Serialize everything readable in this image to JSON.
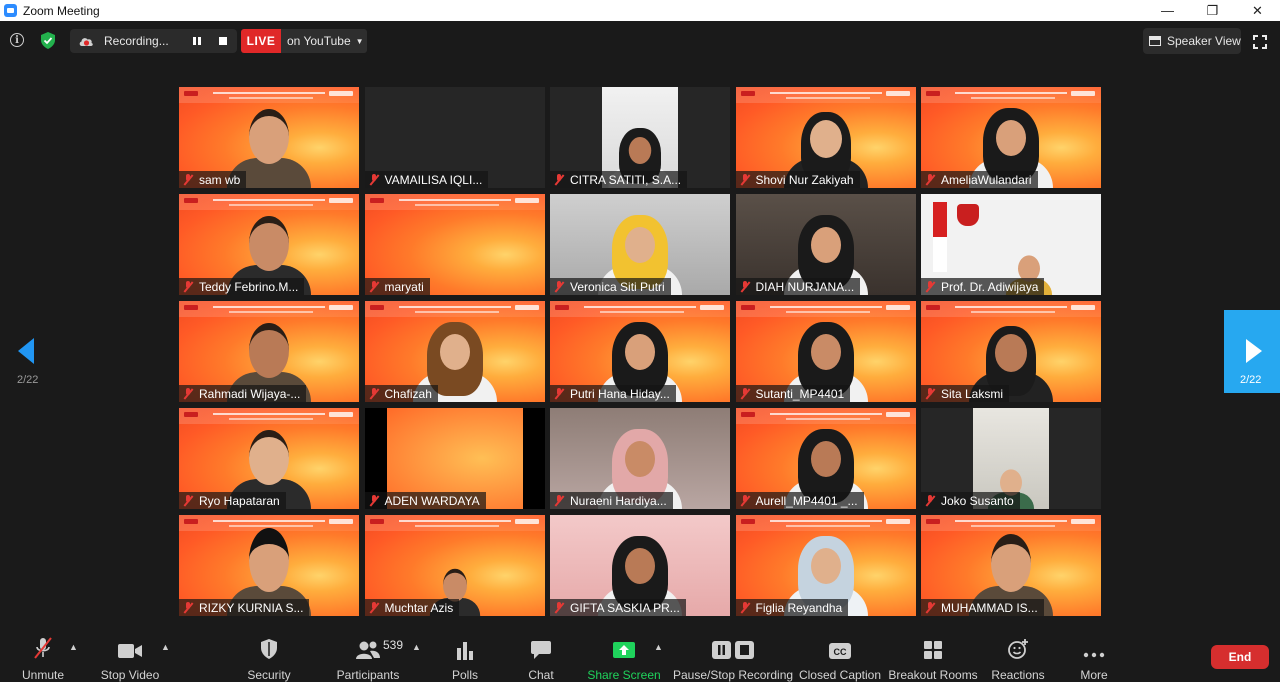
{
  "window": {
    "title": "Zoom Meeting",
    "controls": [
      "—",
      "❐",
      "✕"
    ]
  },
  "topbar": {
    "recording_label": "Recording...",
    "live_label": "LIVE",
    "live_destination": "on YouTube",
    "view_button": "Speaker View"
  },
  "pagination": {
    "left_page": "2/22",
    "right_page": "2/22"
  },
  "participants": [
    {
      "name": "sam wb",
      "bg": "orange",
      "kind": "man"
    },
    {
      "name": "VAMAILISA IQLI...",
      "bg": "dark",
      "kind": "none"
    },
    {
      "name": "CITRA SATITI, S.A...",
      "bg": "dark",
      "kind": "phone"
    },
    {
      "name": "Shovi Nur Zakiyah",
      "bg": "orange",
      "kind": "girl"
    },
    {
      "name": "AmeliaWulandari",
      "bg": "orange",
      "kind": "hijab"
    },
    {
      "name": "Teddy Febrino.M...",
      "bg": "orange",
      "kind": "man"
    },
    {
      "name": "maryati",
      "bg": "orange",
      "kind": "none"
    },
    {
      "name": "Veronica Siti Putri",
      "bg": "gray",
      "kind": "hijab-yellow"
    },
    {
      "name": "DIAH NURJANA...",
      "bg": "dim",
      "kind": "hijab"
    },
    {
      "name": "Prof. Dr. Adiwijaya",
      "bg": "telkom",
      "kind": "man-small"
    },
    {
      "name": "Rahmadi Wijaya-...",
      "bg": "orange",
      "kind": "man"
    },
    {
      "name": "Chafizah",
      "bg": "orange",
      "kind": "hijab-brown"
    },
    {
      "name": "Putri Hana Hiday...",
      "bg": "orange",
      "kind": "hijab"
    },
    {
      "name": "Sutanti_MP4401",
      "bg": "orange",
      "kind": "hijab"
    },
    {
      "name": "Sita Laksmi",
      "bg": "orange",
      "kind": "girl-glasses"
    },
    {
      "name": "Ryo Hapataran",
      "bg": "orange",
      "kind": "man"
    },
    {
      "name": "ADEN WARDAYA",
      "bg": "blackbars",
      "kind": "none"
    },
    {
      "name": "Nuraeni Hardiya...",
      "bg": "room",
      "kind": "hijab-pink"
    },
    {
      "name": "Aurell_MP4401 _...",
      "bg": "orange",
      "kind": "hijab"
    },
    {
      "name": "Joko Susanto",
      "bg": "dark",
      "kind": "phone-man"
    },
    {
      "name": "RIZKY KURNIA S...",
      "bg": "orange",
      "kind": "man-cap"
    },
    {
      "name": "Muchtar Azis",
      "bg": "orange",
      "kind": "man-small"
    },
    {
      "name": "GIFTA SASKIA PR...",
      "bg": "pink",
      "kind": "hijab"
    },
    {
      "name": "Figlia Reyandha",
      "bg": "orange",
      "kind": "hijab-light"
    },
    {
      "name": "MUHAMMAD IS...",
      "bg": "orange",
      "kind": "man-long"
    }
  ],
  "toolbar": {
    "unmute": "Unmute",
    "stop_video": "Stop Video",
    "security": "Security",
    "participants": "Participants",
    "participants_count": "539",
    "polls": "Polls",
    "chat": "Chat",
    "share_screen": "Share Screen",
    "pause_stop_recording": "Pause/Stop Recording",
    "closed_caption": "Closed Caption",
    "cc_icon_text": "CC",
    "breakout_rooms": "Breakout Rooms",
    "reactions": "Reactions",
    "more": "More",
    "end": "End"
  },
  "colors": {
    "accent": "#2196f3",
    "live": "#e02828",
    "share": "#1fd35c",
    "end": "#d62e2e"
  }
}
